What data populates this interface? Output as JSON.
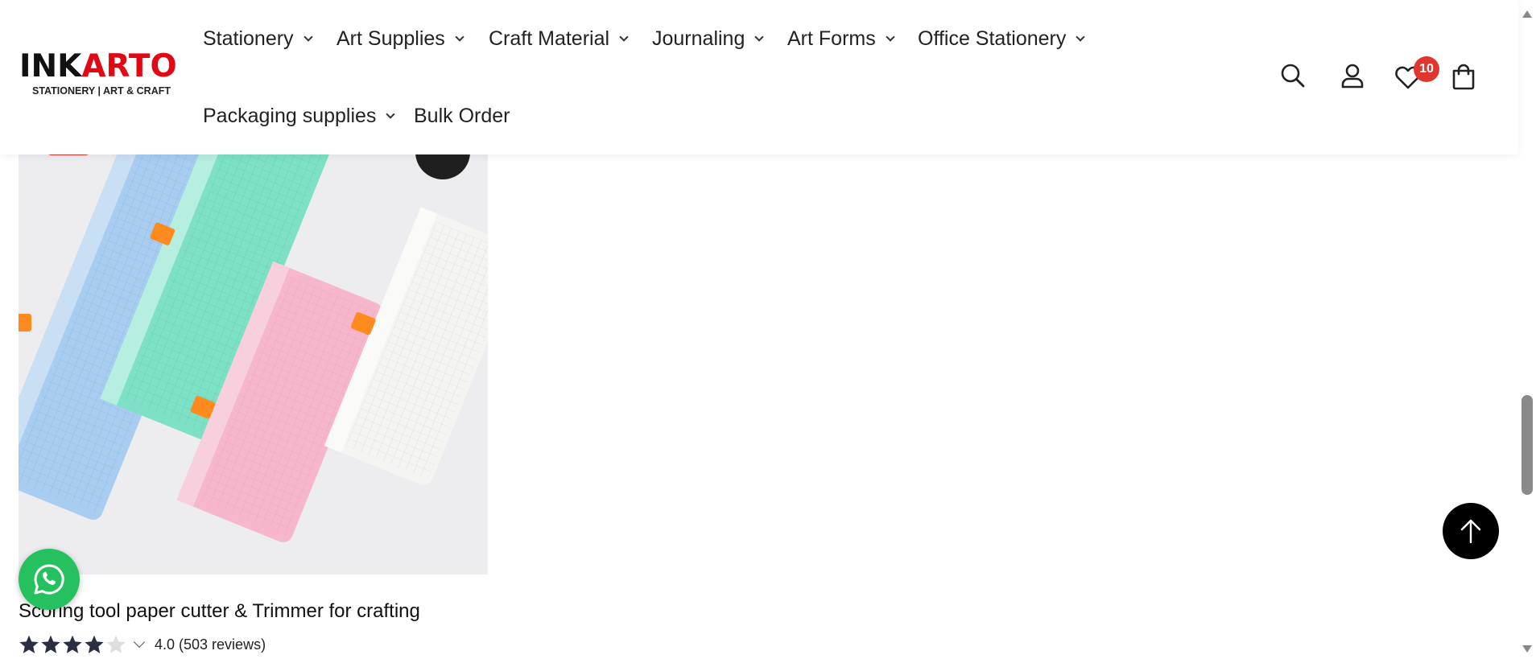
{
  "brand": {
    "logo_part1": "INK",
    "logo_part2": "ARTO",
    "tagline": "STATIONERY | ART & CRAFT",
    "accent_color": "#e30613"
  },
  "nav": {
    "items": [
      {
        "label": "Stationery",
        "has_dropdown": true
      },
      {
        "label": "Art Supplies",
        "has_dropdown": true
      },
      {
        "label": "Craft Material",
        "has_dropdown": true
      },
      {
        "label": "Journaling",
        "has_dropdown": true
      },
      {
        "label": "Art Forms",
        "has_dropdown": true
      },
      {
        "label": "Office Stationery",
        "has_dropdown": true
      },
      {
        "label": "Packaging supplies",
        "has_dropdown": true
      },
      {
        "label": "Bulk Order",
        "has_dropdown": false
      }
    ]
  },
  "header_icons": {
    "search": "search-icon",
    "account": "user-icon",
    "wishlist": "heart-icon",
    "wishlist_count": "10",
    "cart": "shopping-bag-icon"
  },
  "product": {
    "title": "Scoring tool paper cutter & Trimmer for crafting",
    "rating_value": 4.0,
    "rating_text": "4.0 (503 reviews)",
    "stars_filled": 4,
    "stars_total": 5
  },
  "floating": {
    "whatsapp": "whatsapp-icon",
    "back_to_top": "arrow-up-icon"
  },
  "colors": {
    "badge": "#e0362f",
    "whatsapp": "#25c15e",
    "star": "#2b2d42"
  }
}
